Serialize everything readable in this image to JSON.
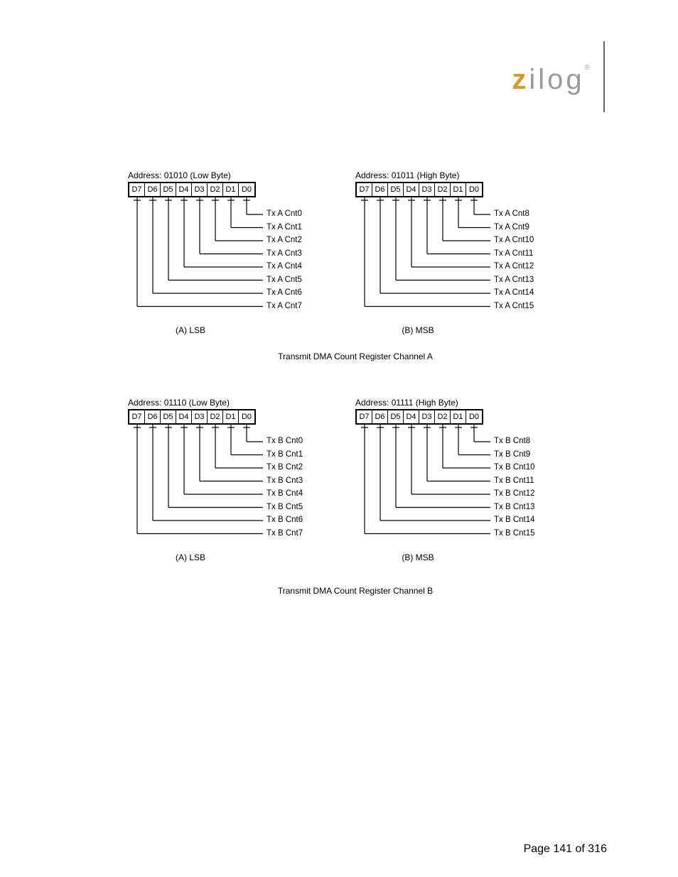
{
  "logo": {
    "z": "z",
    "rest": "ilog"
  },
  "footer": "Page 141 of 316",
  "bit_labels": [
    "D7",
    "D6",
    "D5",
    "D4",
    "D3",
    "D2",
    "D1",
    "D0"
  ],
  "figA": {
    "caption": "Transmit DMA Count Register Channel A",
    "low": {
      "addr": "Address: 01010 (Low Byte)",
      "signals": [
        "Tx A Cnt0",
        "Tx A Cnt1",
        "Tx A Cnt2",
        "Tx A Cnt3",
        "Tx A Cnt4",
        "Tx A Cnt5",
        "Tx A Cnt6",
        "Tx A Cnt7"
      ],
      "sub": "(A) LSB"
    },
    "high": {
      "addr": "Address: 01011 (High Byte)",
      "signals": [
        "Tx A Cnt8",
        "Tx A Cnt9",
        "Tx A Cnt10",
        "Tx A Cnt11",
        "Tx A Cnt12",
        "Tx A Cnt13",
        "Tx A Cnt14",
        "Tx A Cnt15"
      ],
      "sub": "(B) MSB"
    }
  },
  "figB": {
    "caption": "Transmit DMA Count Register Channel B",
    "low": {
      "addr": "Address: 01110 (Low Byte)",
      "signals": [
        "Tx B Cnt0",
        "Tx B Cnt1",
        "Tx B Cnt2",
        "Tx B Cnt3",
        "Tx B Cnt4",
        "Tx B Cnt5",
        "Tx B Cnt6",
        "Tx B Cnt7"
      ],
      "sub": "(A) LSB"
    },
    "high": {
      "addr": "Address: 01111 (High Byte)",
      "signals": [
        "Tx B Cnt8",
        "Tx B Cnt9",
        "Tx B Cnt10",
        "Tx B Cnt11",
        "Tx B Cnt12",
        "Tx B Cnt13",
        "Tx B Cnt14",
        "Tx B Cnt15"
      ],
      "sub": "(B) MSB"
    }
  }
}
